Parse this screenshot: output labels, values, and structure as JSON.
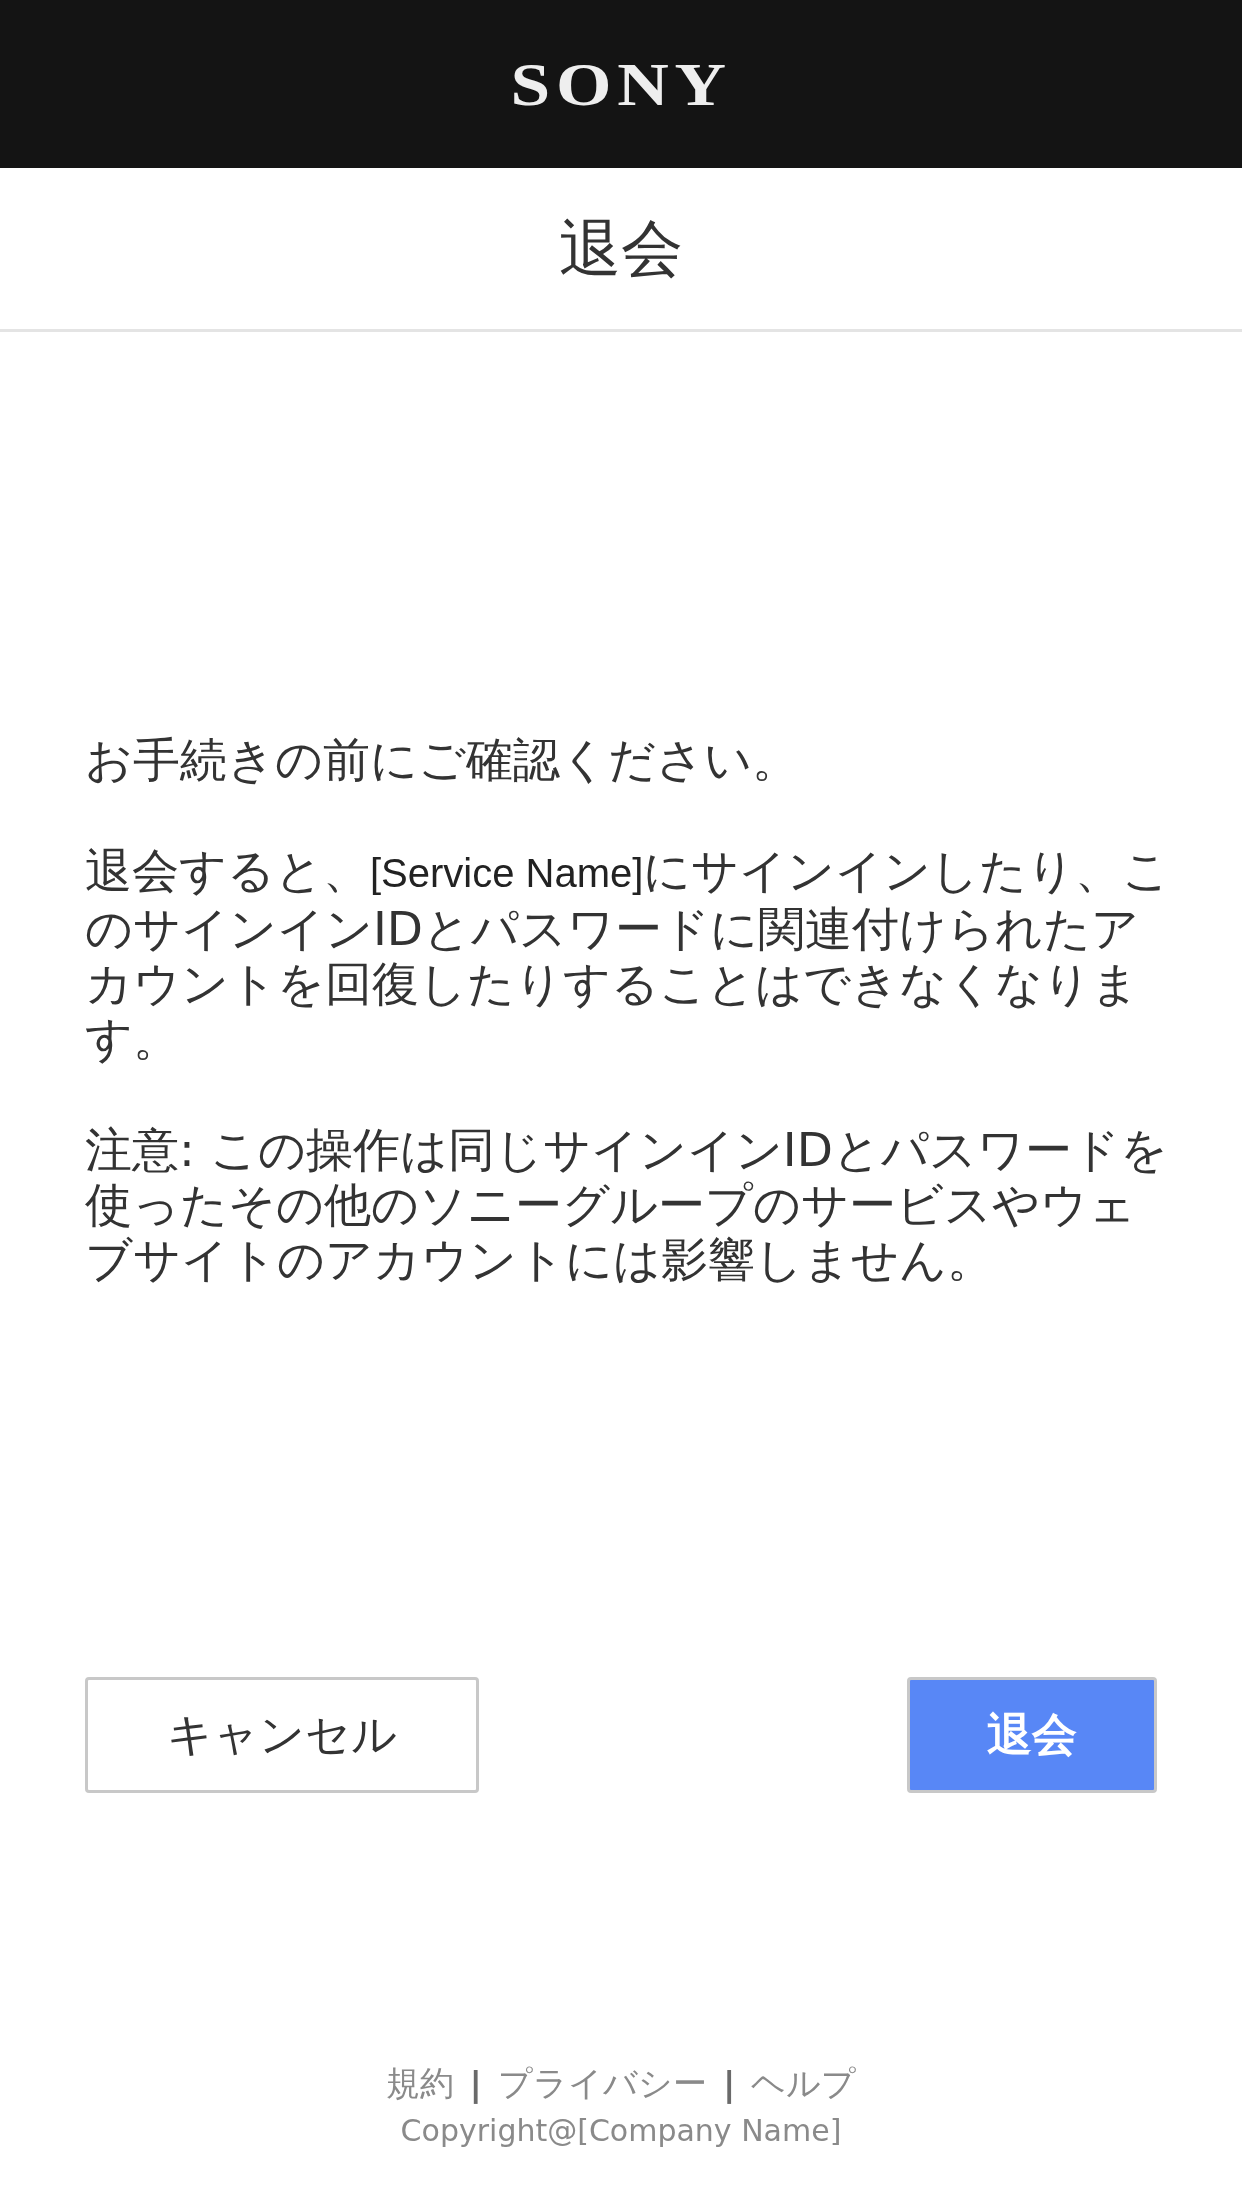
{
  "header": {
    "logo": "SONY"
  },
  "title": "退会",
  "paragraphs": [
    [
      {
        "kind": "plain",
        "text": "お手続きの前にご確認ください。"
      }
    ],
    [
      {
        "kind": "plain",
        "text": "退会すると、"
      },
      {
        "kind": "inserted",
        "text": "[Service Name]"
      },
      {
        "kind": "plain",
        "text": "にサインインしたり、このサインインIDとパスワードに関連付けられたアカウントを回復したりすることはできなくなります。"
      }
    ],
    [
      {
        "kind": "plain",
        "text": "注意: この操作は同じサインインIDとパスワードを使ったその他のソニーグループのサービスやウェブサイトのアカウントには影響しません。"
      }
    ]
  ],
  "buttons": [
    {
      "kind": "secondary",
      "label": "キャンセル"
    },
    {
      "kind": "primary",
      "label": "退会"
    }
  ],
  "footer": {
    "items": [
      {
        "kind": "link",
        "text": "規約"
      },
      {
        "kind": "separator",
        "text": "|"
      },
      {
        "kind": "link",
        "text": "プライバシー"
      },
      {
        "kind": "separator",
        "text": "|"
      },
      {
        "kind": "link",
        "text": "ヘルプ"
      }
    ],
    "copyright": "Copyright@[Company Name]"
  }
}
